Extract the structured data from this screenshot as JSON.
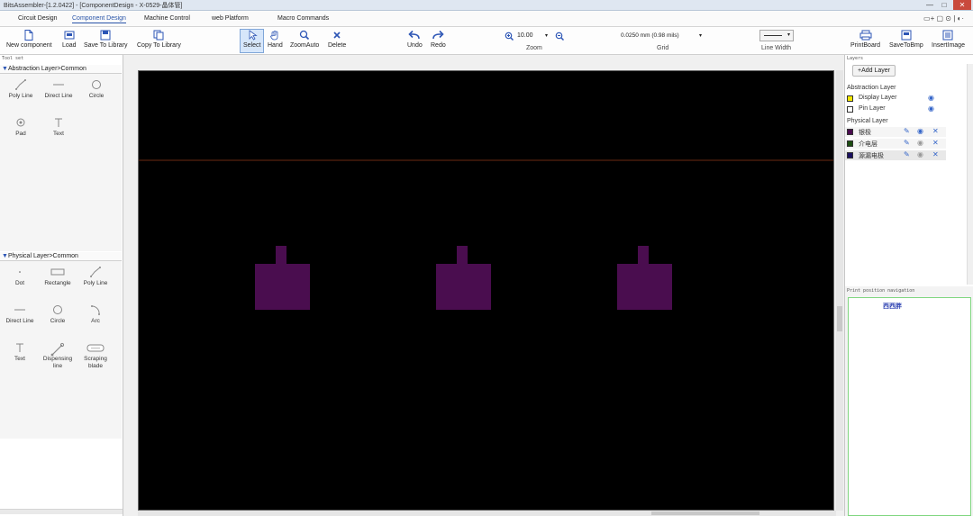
{
  "window": {
    "title": "BitsAssembler-[1.2.0422] - [ComponentDesign - X-0529-晶体管]",
    "controls": [
      "—",
      "□",
      "✕"
    ]
  },
  "menu": {
    "items": [
      "Circuit Design",
      "Component Design",
      "Machine Control",
      "web Platform",
      "Macro Commands"
    ],
    "active": "Component Design",
    "right_icons": "▭+ ▢ ⊙ | ◐·"
  },
  "toolbar": {
    "new_component": "New component",
    "load": "Load",
    "save_to_library": "Save To Library",
    "copy_to_library": "Copy To Library",
    "select": "Select",
    "hand": "Hand",
    "zoom_auto": "ZoomAuto",
    "delete": "Delete",
    "undo": "Undo",
    "redo": "Redo",
    "zoom_value": "10.00",
    "zoom_label": "Zoom",
    "grid_value": "0.0250 mm (0.98 mils)",
    "grid_label": "Grid",
    "line_width_label": "Line Width",
    "print_board": "PrintBoard",
    "save_to_bmp": "SaveToBmp",
    "insert_image": "InsertImage"
  },
  "tool_panel": {
    "title": "Tool set",
    "abstraction_header": "Abstraction Layer>Common",
    "abstraction_tools": [
      "Poly Line",
      "Direct Line",
      "Circle",
      "Pad",
      "Text"
    ],
    "physical_header": "Physical Layer>Common",
    "physical_tools": [
      "Dot",
      "Rectangle",
      "Poly Line",
      "Direct Line",
      "Circle",
      "Arc",
      "Text",
      "Dispensing line",
      "Scraping blade"
    ]
  },
  "layers_panel": {
    "title": "Layers",
    "add_layer": "+Add Layer",
    "abstraction_group": "Abstraction Layer",
    "abstraction_layers": [
      {
        "name": "Display Layer",
        "color": "#f2e600"
      },
      {
        "name": "Pin Layer",
        "color": "#ffffff"
      }
    ],
    "physical_group": "Physical Layer",
    "physical_layers": [
      {
        "name": "银极",
        "color": "#4a0d4f"
      },
      {
        "name": "介电层",
        "color": "#1d4d12"
      },
      {
        "name": "源漏电极",
        "color": "#1a1060"
      }
    ]
  },
  "navigation": {
    "title": "Print position navigation",
    "label": "西西胖"
  },
  "canvas": {
    "background": "#000000",
    "guide_color": "#6b2a12",
    "pad_color": "#4a0d4f",
    "pad_count": 3
  }
}
